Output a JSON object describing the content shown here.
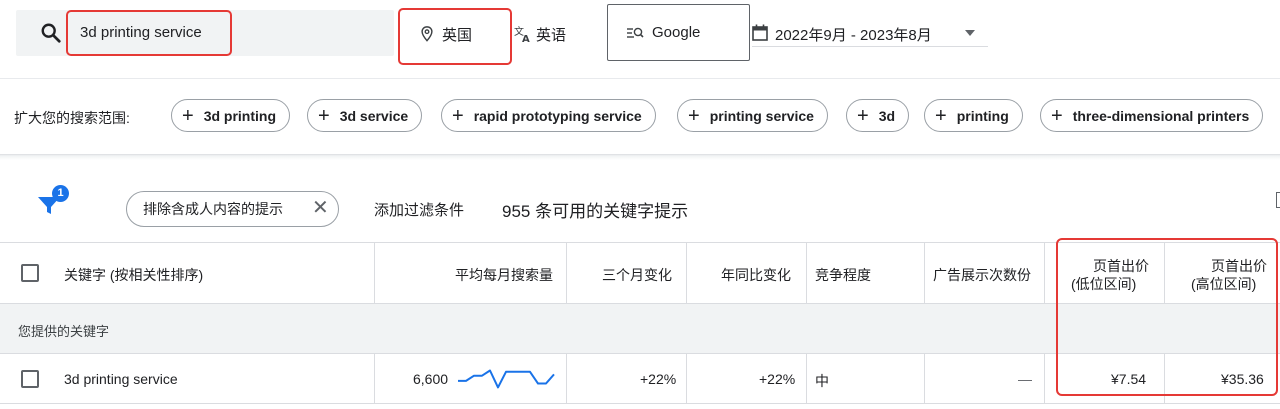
{
  "search": {
    "query": "3d printing service",
    "location": "英国",
    "language": "英语",
    "engine": "Google",
    "date_range": "2022年9月 - 2023年8月"
  },
  "expand": {
    "label": "扩大您的搜索范围:",
    "chips": [
      "3d printing",
      "3d service",
      "rapid prototyping service",
      "printing service",
      "3d",
      "printing",
      "three-dimensional printers"
    ]
  },
  "filters": {
    "badge_count": "1",
    "adult_chip": "排除含成人内容的提示",
    "add_filter": "添加过滤条件",
    "result_count": "955 条可用的关键字提示"
  },
  "table": {
    "headers": {
      "keyword": "关键字 (按相关性排序)",
      "avg_monthly": "平均每月搜索量",
      "three_month": "三个月变化",
      "yoy": "年同比变化",
      "competition": "竞争程度",
      "impression_share": "广告展示次数份",
      "bid_low_1": "页首出价",
      "bid_low_2": "(低位区间)",
      "bid_high_1": "页首出价",
      "bid_high_2": "(高位区间)"
    },
    "group_label": "您提供的关键字",
    "rows": [
      {
        "keyword": "3d printing service",
        "avg_monthly": "6,600",
        "three_month": "+22%",
        "yoy": "+22%",
        "competition": "中",
        "impression_share": "—",
        "bid_low": "¥7.54",
        "bid_high": "¥35.36",
        "trend": [
          0.35,
          0.35,
          0.55,
          0.55,
          0.75,
          0.1,
          0.7,
          0.7,
          0.7,
          0.7,
          0.25,
          0.25,
          0.6
        ]
      }
    ]
  },
  "colors": {
    "highlight": "#e53935",
    "accent": "#1a73e8",
    "sparkline": "#1a73e8"
  }
}
